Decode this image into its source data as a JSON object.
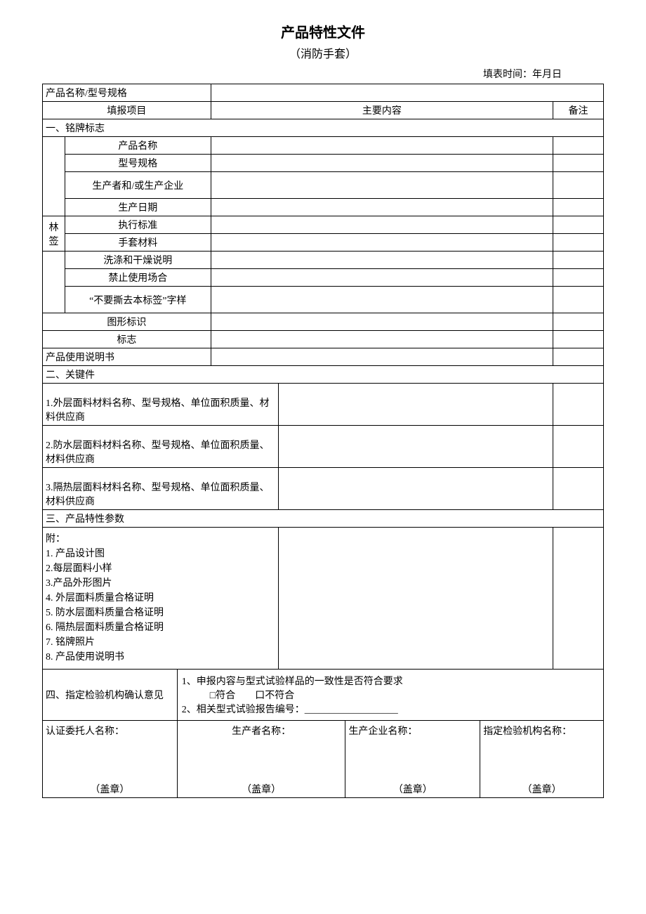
{
  "title": "产品特性文件",
  "subtitle": "（消防手套）",
  "date_label": "填表时间：年月日",
  "rows": {
    "r1c1": "产品名称/型号规格",
    "r2c1": "填报项目",
    "r2c2": "主要内容",
    "r2c3": "备注",
    "sec1": "一、铭牌标志",
    "lin_qian": "林签",
    "label_product_name": "产品名称",
    "label_model": "型号规格",
    "label_producer": "生产者和/或生产企业",
    "label_prod_date": "生产日期",
    "label_standard": "执行标准",
    "label_material": "手套材料",
    "label_wash": "洗涤和干燥说明",
    "label_prohibit": "禁止使用场合",
    "label_no_tear": "“不要撕去本标签”字样",
    "label_graphic": "图形标识",
    "label_mark": "标志",
    "label_manual": "产品使用说明书",
    "sec2": "二、关键件",
    "key1": "1.外层面料材料名称、型号规格、单位面积质量、材料供应商",
    "key2": "2.防水层面料材料名称、型号规格、单位面积质量、材料供应商",
    "key3": "3.隔热层面料材料名称、型号规格、单位面积质量、材料供应商",
    "sec3": "三、产品特性参数",
    "attach_header": "附：",
    "attach1": "1. 产品设计图",
    "attach2": "2.每层面料小样",
    "attach3": "3.产品外形图片",
    "attach4": "4. 外层面料质量合格证明",
    "attach5": "5. 防水层面料质量合格证明",
    "attach6": "6. 隔热层面料质量合格证明",
    "attach7": "7. 铭牌照片",
    "attach8": "8. 产品使用说明书",
    "sec4": "四、指定检验机构确认意见",
    "sec4_line1": "1、申报内容与型式试验样品的一致性是否符合要求",
    "sec4_cb1": "□符合",
    "sec4_cb2": "口不符合",
    "sec4_line2": "2、相关型式试验报告编号：___________________",
    "sig1": "认证委托人名称：",
    "sig2": "生产者名称：",
    "sig3": "生产企业名称：",
    "sig4": "指定检验机构名称：",
    "seal": "（盖章）"
  }
}
